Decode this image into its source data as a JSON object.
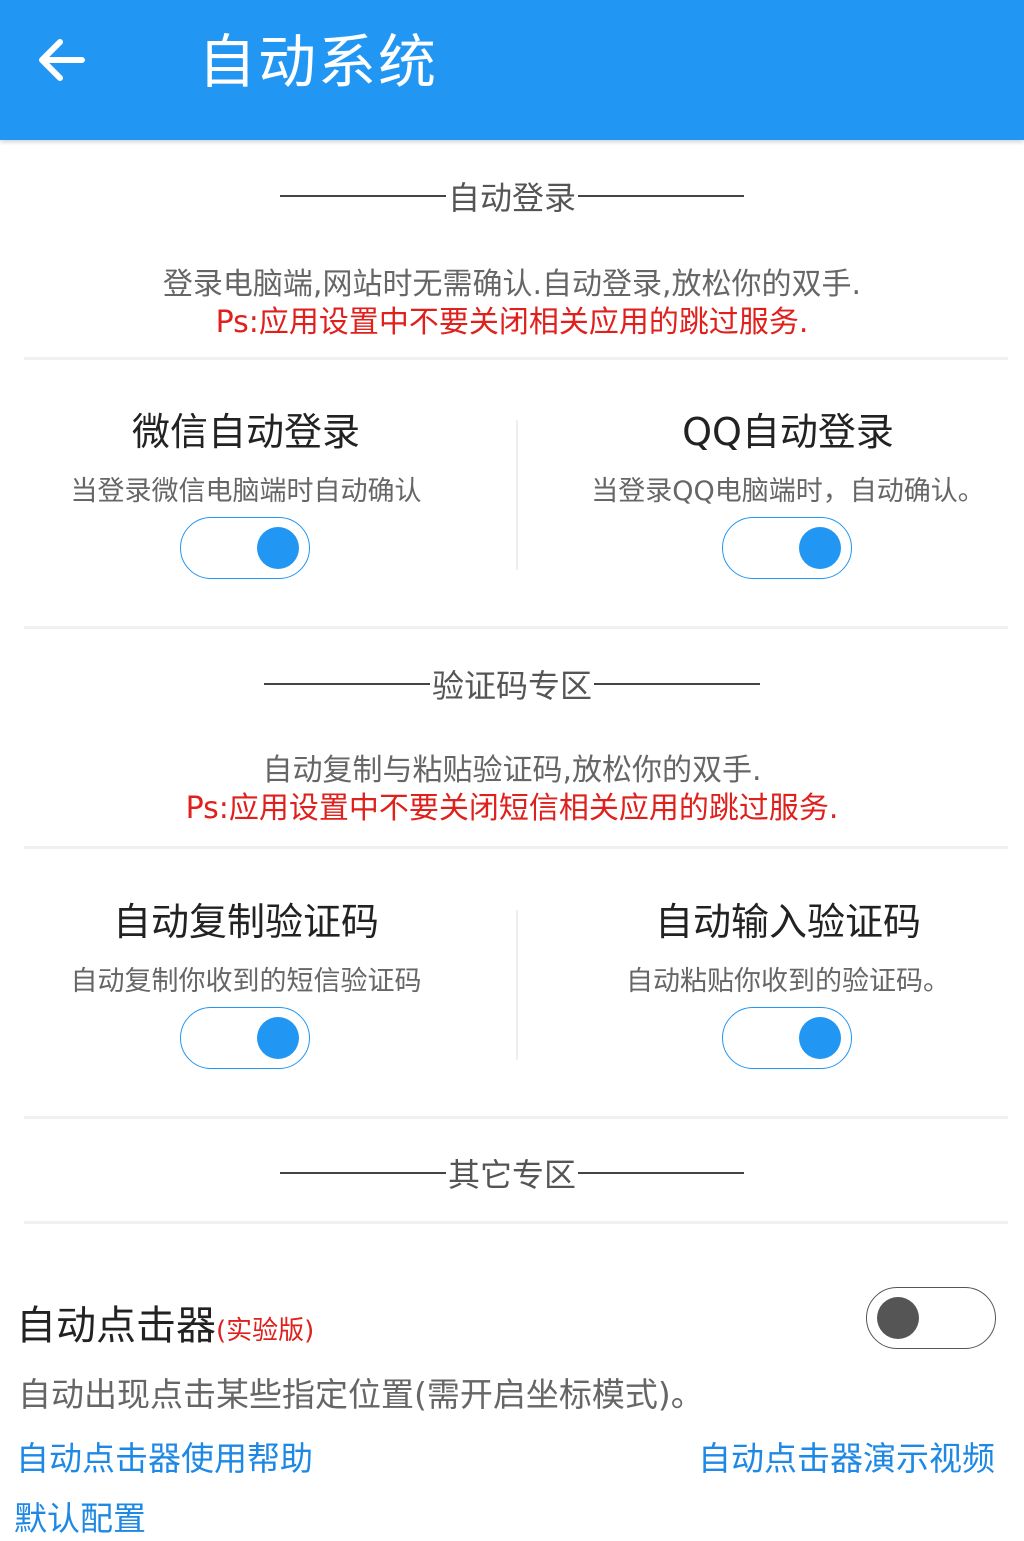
{
  "appbar": {
    "title": "自动系统",
    "color": "#2196F3",
    "back_icon": "arrow-left-icon"
  },
  "auto_login": {
    "header": "自动登录",
    "desc": "登录电脑端,网站时无需确认.自动登录,放松你的双手.",
    "warning": "Ps:应用设置中不要关闭相关应用的跳过服务.",
    "items": [
      {
        "title": "微信自动登录",
        "subtitle": "当登录微信电脑端时自动确认",
        "enabled": true
      },
      {
        "title": "QQ自动登录",
        "subtitle": "当登录QQ电脑端时，自动确认。",
        "enabled": true
      }
    ]
  },
  "captcha": {
    "header": "验证码专区",
    "desc": "自动复制与粘贴验证码,放松你的双手.",
    "warning": "Ps:应用设置中不要关闭短信相关应用的跳过服务.",
    "items": [
      {
        "title": "自动复制验证码",
        "subtitle": "自动复制你收到的短信验证码",
        "enabled": true
      },
      {
        "title": "自动输入验证码",
        "subtitle": "自动粘贴你收到的验证码。",
        "enabled": true
      }
    ]
  },
  "other": {
    "header": "其它专区",
    "clicker": {
      "title": "自动点击器",
      "tag": "(实验版)",
      "desc": "自动出现点击某些指定位置(需开启坐标模式)。",
      "enabled": false
    },
    "links": {
      "help": "自动点击器使用帮助",
      "demo": "自动点击器演示视频",
      "default_config": "默认配置"
    }
  },
  "colors": {
    "accent": "#2196F3",
    "warning": "#e0201c",
    "link": "#1E88E5"
  }
}
